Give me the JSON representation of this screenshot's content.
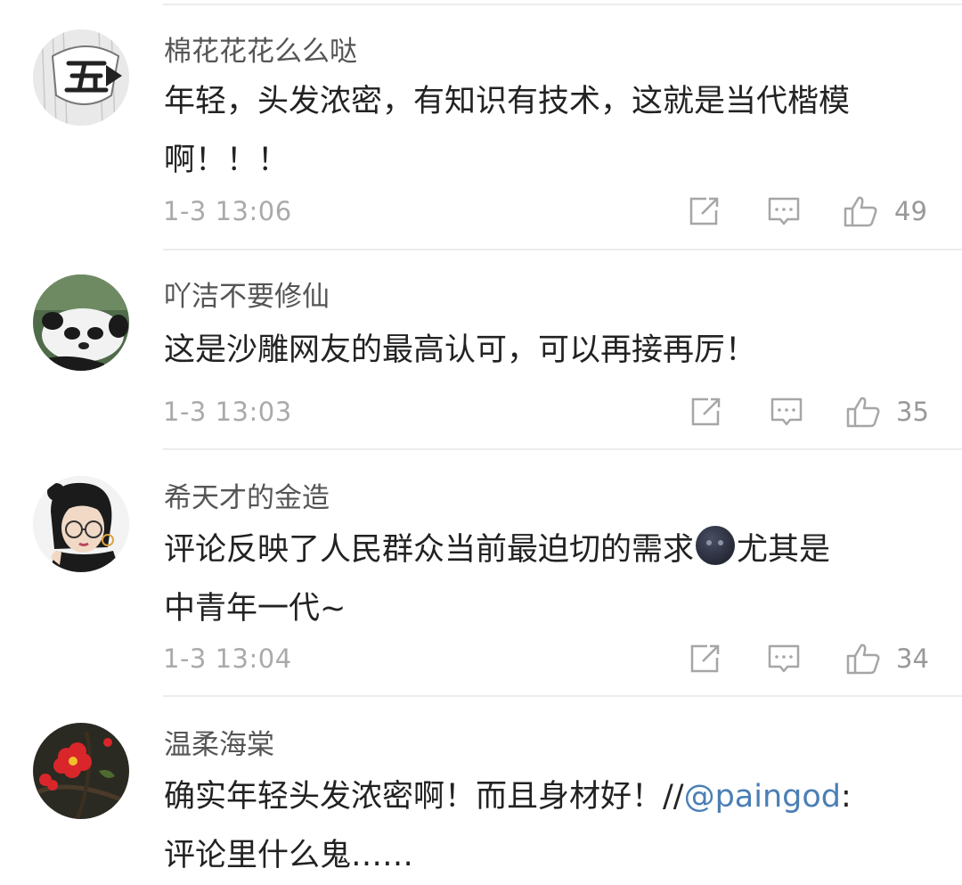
{
  "comments": [
    {
      "username": "棉花花花么么哒",
      "text_lines": [
        "年轻，头发浓密，有知识有技术，这就是当代楷模",
        "啊！！！"
      ],
      "timestamp": "1-3 13:06",
      "likes": "49",
      "avatar_icon": "calligraphy-avatar-icon"
    },
    {
      "username": "吖洁不要修仙",
      "text_lines": [
        "这是沙雕网友的最高认可，可以再接再厉！"
      ],
      "timestamp": "1-3 13:03",
      "likes": "35",
      "avatar_icon": "panda-avatar-icon"
    },
    {
      "username": "希天才的金造",
      "text_line1_before": "评论反映了人民群众当前最迫切的需求",
      "text_line1_after": "尤其是",
      "text_line2": "中青年一代~",
      "emoji": "new-moon-face-emoji",
      "timestamp": "1-3 13:04",
      "likes": "34",
      "avatar_icon": "girl-glasses-avatar-icon"
    },
    {
      "username": "温柔海棠",
      "text_line1_before": "确实年轻头发浓密啊！而且身材好！//",
      "mention": "@paingod",
      "text_line1_after": ":",
      "text_line2": "评论里什么鬼……",
      "avatar_icon": "red-flower-avatar-icon"
    }
  ],
  "icons": {
    "forward": "forward-icon",
    "reply": "comment-icon",
    "like": "thumbs-up-icon"
  },
  "colors": {
    "username": "#555555",
    "text": "#222222",
    "meta": "#aaaaaa",
    "mention": "#4a7fb5",
    "divider": "#ececec"
  }
}
